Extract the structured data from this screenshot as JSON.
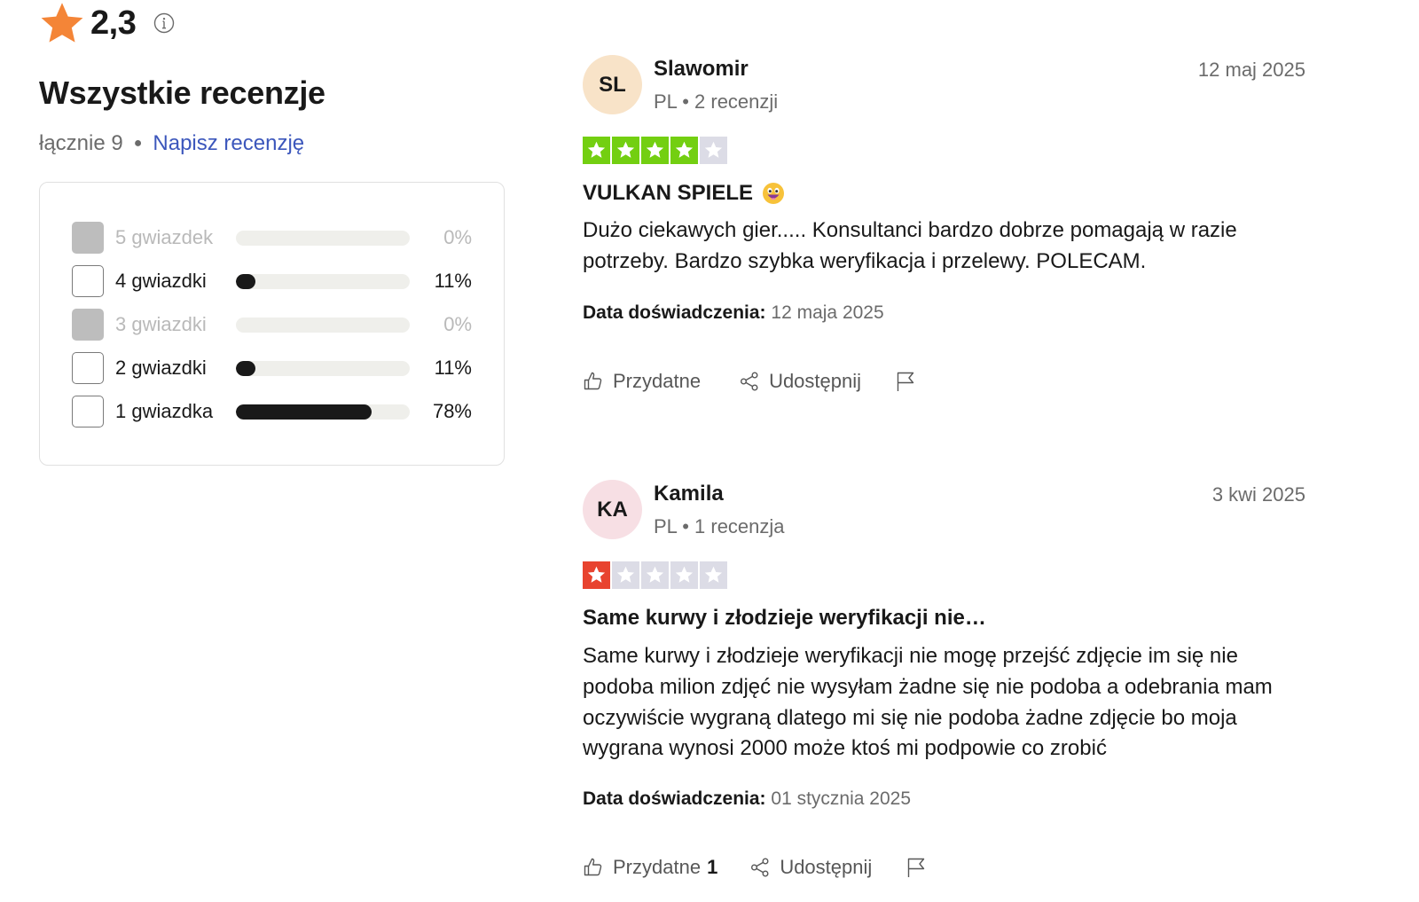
{
  "summary": {
    "rating": "2,3",
    "heading": "Wszystkie recenzje",
    "total_label": "łącznie 9",
    "write_link": "Napisz recenzję",
    "star_color": "#f48537"
  },
  "distribution": [
    {
      "label": "5 gwiazdek",
      "percent": "0%",
      "fraction": 0.0,
      "enabled": false
    },
    {
      "label": "4 gwiazdki",
      "percent": "11%",
      "fraction": 0.11,
      "enabled": true
    },
    {
      "label": "3 gwiazdki",
      "percent": "0%",
      "fraction": 0.0,
      "enabled": false
    },
    {
      "label": "2 gwiazdki",
      "percent": "11%",
      "fraction": 0.11,
      "enabled": true
    },
    {
      "label": "1 gwiazdka",
      "percent": "78%",
      "fraction": 0.78,
      "enabled": true
    }
  ],
  "reviews": [
    {
      "initials": "SL",
      "avatar_color": "#f8e3c8",
      "name": "Slawomir",
      "meta": "PL • 2 recenzji",
      "date": "12 maj 2025",
      "stars": 4,
      "star_color": "#73cf11",
      "title": "VULKAN SPIELE",
      "title_emoji": "grinning-face-emoji",
      "body": "Dużo ciekawych gier..... Konsultanci bardzo dobrze pomagają w razie potrzeby. Bardzo szybka weryfikacja i przelewy. POLECAM.",
      "experience_label": "Data doświadczenia:",
      "experience_date": "12 maja 2025",
      "useful_label": "Przydatne",
      "useful_count": "",
      "share_label": "Udostępnij"
    },
    {
      "initials": "KA",
      "avatar_color": "#f7dfe4",
      "name": "Kamila",
      "meta": "PL • 1 recenzja",
      "date": "3 kwi 2025",
      "stars": 1,
      "star_color": "#e8432f",
      "title": "Same kurwy i złodzieje weryfikacji nie…",
      "title_emoji": "",
      "body": "Same kurwy i złodzieje weryfikacji nie mogę przejść zdjęcie im się nie podoba milion zdjęć nie wysyłam żadne się nie podoba a odebrania mam oczywiście wygraną dlatego mi się nie podoba żadne zdjęcie bo moja wygrana wynosi 2000 może ktoś mi podpowie co zrobić",
      "experience_label": "Data doświadczenia:",
      "experience_date": "01 stycznia 2025",
      "useful_label": "Przydatne",
      "useful_count": "1",
      "share_label": "Udostępnij"
    }
  ]
}
